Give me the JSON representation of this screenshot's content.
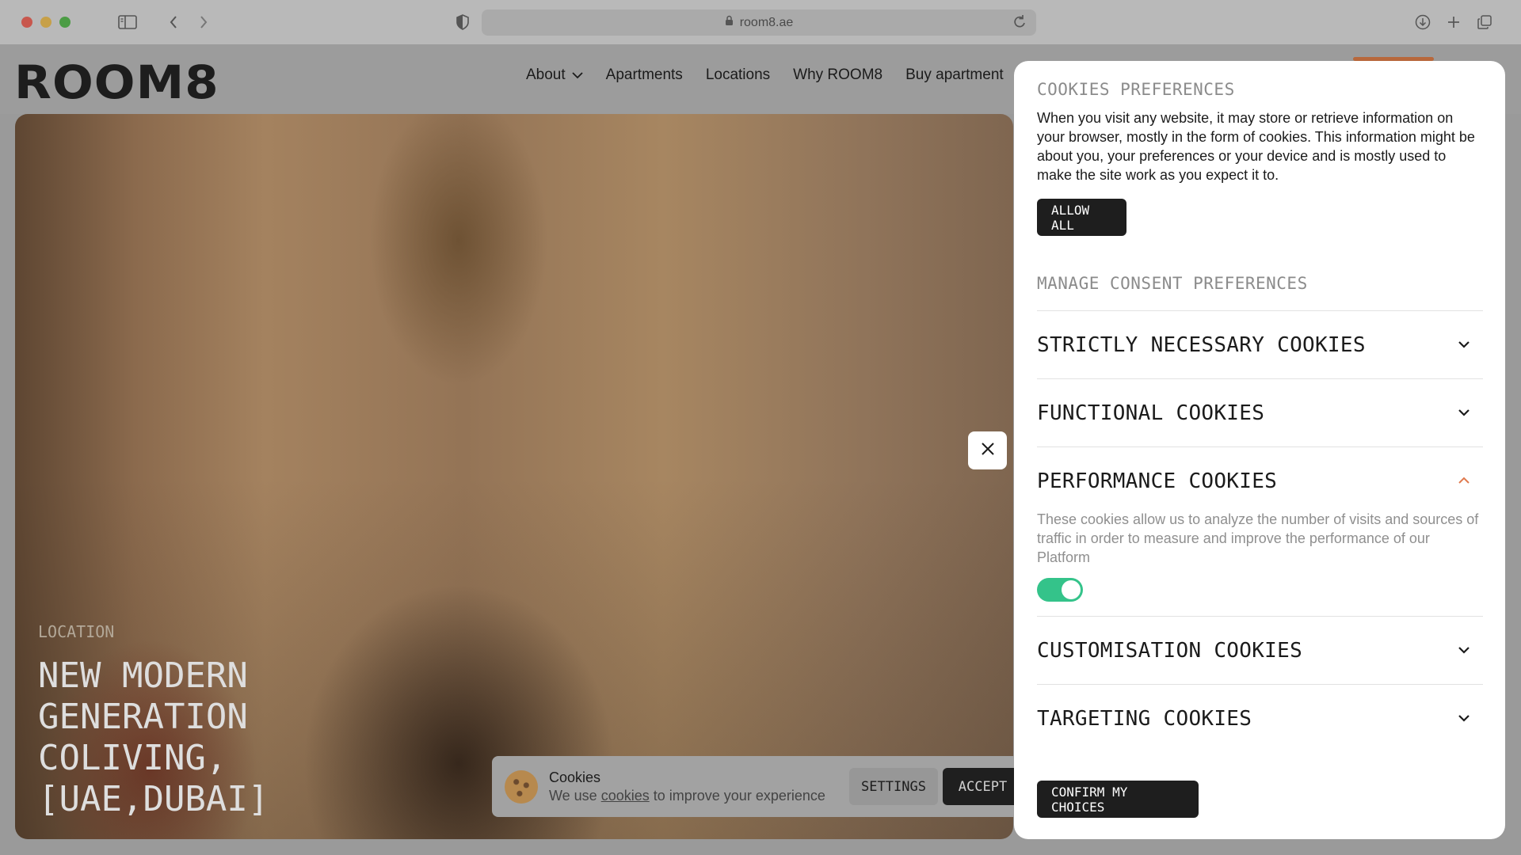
{
  "browser": {
    "url": "room8.ae",
    "icons": [
      "sidebar-icon",
      "back-icon",
      "forward-icon",
      "shield-icon",
      "lock-icon",
      "reload-icon",
      "download-icon",
      "new-tab-icon",
      "tabs-overview-icon"
    ]
  },
  "header": {
    "logo": "ROOM8",
    "nav": [
      {
        "label": "About",
        "has_dropdown": true
      },
      {
        "label": "Apartments"
      },
      {
        "label": "Locations"
      },
      {
        "label": "Why ROOM8"
      },
      {
        "label": "Buy apartment"
      }
    ]
  },
  "hero": {
    "eyebrow": "LOCATION",
    "title": "NEW MODERN\nGENERATION COLIVING,\n[UAE,DUBAI]"
  },
  "cookie_bar": {
    "title": "Cookies",
    "text_prefix": "We use",
    "link": "cookies",
    "text_suffix": "to improve your experience",
    "settings_label": "SETTINGS",
    "accept_label": "ACCEPT"
  },
  "modal": {
    "title": "COOKIES PREFERENCES",
    "description": "When you visit any website, it may store or retrieve information on your browser, mostly in the form of cookies. This information might be about you, your preferences or your device and is mostly used to make the site work as you expect it to.",
    "allow_all_label": "ALLOW ALL",
    "manage_title": "MANAGE CONSENT PREFERENCES",
    "categories": [
      {
        "label": "STRICTLY NECESSARY COOKIES",
        "expanded": false
      },
      {
        "label": "FUNCTIONAL COOKIES",
        "expanded": false
      },
      {
        "label": "PERFORMANCE COOKIES",
        "expanded": true,
        "description": "These cookies allow us to analyze the number of visits and sources of traffic in order to measure and improve the performance of our Platform",
        "enabled": true
      },
      {
        "label": "CUSTOMISATION COOKIES",
        "expanded": false
      },
      {
        "label": "TARGETING COOKIES",
        "expanded": false
      }
    ],
    "confirm_label": "CONFIRM MY CHOICES"
  },
  "colors": {
    "accent_orange": "#e07a4e",
    "toggle_on": "#34c38a",
    "dark_button": "#1e1e1e"
  }
}
